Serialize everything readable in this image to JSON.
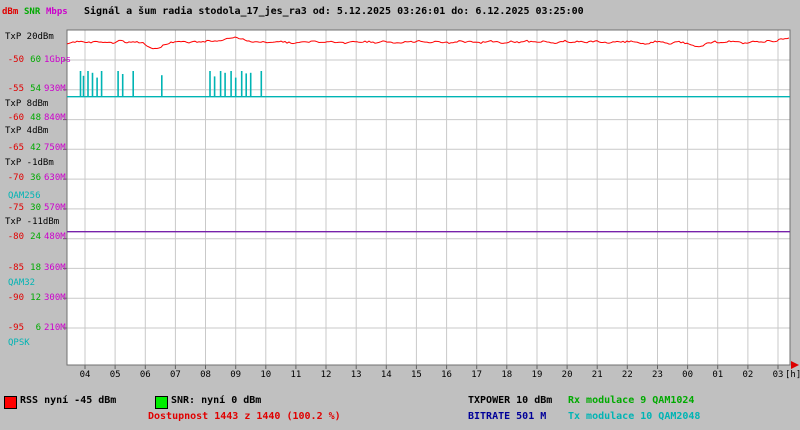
{
  "header": {
    "unit_dbm": "dBm",
    "unit_snr": "SNR",
    "unit_mbps": "Mbps",
    "title": "Signál a šum radia stodola_17_jes_ra3 od: 5.12.2025 03:26:01 do: 6.12.2025 03:25:00"
  },
  "colors": {
    "page_bg": "#c0c0c0",
    "plot_bg": "#ffffff",
    "grid": "#c9c9c9",
    "border": "#707070",
    "rss": "#ff0000",
    "snr_swatch": "#00ee00",
    "mbps_axis": "#cc00cc",
    "modulation": "#00b4b4",
    "bitrate_line": "#7722aa",
    "bitrate_text": "#000099",
    "rx_mod_text": "#00aa00",
    "availability_text": "#e00000"
  },
  "axis": {
    "left_rows": [
      {
        "y": 60,
        "dbm": "-50",
        "snr": "60",
        "mbps": "1Gbps"
      },
      {
        "y": 89,
        "dbm": "-55",
        "snr": "54",
        "mbps": "930M"
      },
      {
        "y": 118,
        "dbm": "-60",
        "snr": "48",
        "mbps": "840M"
      },
      {
        "y": 148,
        "dbm": "-65",
        "snr": "42",
        "mbps": "750M"
      },
      {
        "y": 178,
        "dbm": "-70",
        "snr": "36",
        "mbps": "630M"
      },
      {
        "y": 208,
        "dbm": "-75",
        "snr": "30",
        "mbps": "570M"
      },
      {
        "y": 237,
        "dbm": "-80",
        "snr": "24",
        "mbps": "480M"
      },
      {
        "y": 268,
        "dbm": "-85",
        "snr": "18",
        "mbps": "360M"
      },
      {
        "y": 298,
        "dbm": "-90",
        "snr": "12",
        "mbps": "300M"
      },
      {
        "y": 328,
        "dbm": "-95",
        "snr": "6",
        "mbps": "210M"
      }
    ],
    "txp_rows": [
      {
        "y": 37,
        "label": "TxP 20dBm"
      },
      {
        "y": 104,
        "label": "TxP 8dBm"
      },
      {
        "y": 131,
        "label": "TxP 4dBm"
      },
      {
        "y": 163,
        "label": "TxP -1dBm"
      },
      {
        "y": 222,
        "label": "TxP -11dBm"
      }
    ],
    "mod_rows": [
      {
        "y": 196,
        "label": "QAM256"
      },
      {
        "y": 283,
        "label": "QAM32"
      },
      {
        "y": 343,
        "label": "QPSK"
      }
    ],
    "x_labels": [
      "04",
      "05",
      "06",
      "07",
      "08",
      "09",
      "10",
      "11",
      "12",
      "13",
      "14",
      "15",
      "16",
      "17",
      "18",
      "19",
      "20",
      "21",
      "22",
      "23",
      "00",
      "01",
      "02",
      "03"
    ],
    "x_unit": "[h]"
  },
  "legend": {
    "rss": "RSS nyní -45 dBm",
    "snr": "SNR: nyní 0 dBm",
    "availability": "Dostupnost 1443 z 1440 (100.2 %)",
    "txpower": "TXPOWER 10 dBm",
    "rx_mod": "Rx modulace 9 QAM1024",
    "bitrate": "BITRATE 501 M",
    "tx_mod": "Tx modulace 10 QAM2048"
  },
  "chart_data": {
    "type": "line",
    "title": "Signál a šum radia stodola_17_jes_ra3",
    "time_from": "5.12.2025 03:26:01",
    "time_to": "6.12.2025 03:25:00",
    "x_axis": {
      "unit": "[h]",
      "tick_labels": [
        "04",
        "05",
        "06",
        "07",
        "08",
        "09",
        "10",
        "11",
        "12",
        "13",
        "14",
        "15",
        "16",
        "17",
        "18",
        "19",
        "20",
        "21",
        "22",
        "23",
        "00",
        "01",
        "02",
        "03"
      ],
      "start_hour": 3.43,
      "end_hour": 27.42
    },
    "y_axes": {
      "rss_dbm_ticks": [
        -50,
        -55,
        -60,
        -65,
        -70,
        -75,
        -80,
        -85,
        -90,
        -95
      ],
      "snr_db_ticks": [
        60,
        54,
        48,
        42,
        36,
        30,
        24,
        18,
        12,
        6
      ],
      "bitrate_tick_labels": [
        "1Gbps",
        "930M",
        "840M",
        "750M",
        "630M",
        "570M",
        "480M",
        "360M",
        "300M",
        "210M"
      ],
      "txp_dbm_ticks": [
        20,
        8,
        4,
        -1,
        -11
      ],
      "modulation_ticks": [
        "QAM256",
        "QAM32",
        "QPSK"
      ]
    },
    "series": [
      {
        "name": "RSS",
        "unit": "dBm",
        "now": -45,
        "color": "#ff0000",
        "start_hour": 3.4,
        "step_hours": 0.25,
        "values": [
          -47.3,
          -47.0,
          -46.8,
          -47.1,
          -46.9,
          -47.0,
          -47.2,
          -46.8,
          -47.0,
          -46.9,
          -47.1,
          -47.9,
          -48.2,
          -47.4,
          -47.0,
          -46.8,
          -47.1,
          -46.9,
          -47.0,
          -46.7,
          -46.9,
          -46.5,
          -46.2,
          -46.4,
          -46.8,
          -47.0,
          -46.9,
          -47.1,
          -46.8,
          -47.0,
          -47.2,
          -46.9,
          -47.0,
          -46.8,
          -47.1,
          -46.9,
          -47.0,
          -47.2,
          -46.8,
          -47.0,
          -46.9,
          -47.1,
          -46.8,
          -47.0,
          -47.2,
          -46.9,
          -47.0,
          -46.8,
          -47.1,
          -46.9,
          -47.0,
          -47.2,
          -46.8,
          -47.0,
          -46.9,
          -47.1,
          -46.8,
          -47.0,
          -47.2,
          -46.9,
          -47.0,
          -46.8,
          -47.1,
          -46.9,
          -47.0,
          -47.2,
          -46.8,
          -47.0,
          -46.9,
          -47.1,
          -46.8,
          -47.0,
          -47.2,
          -46.9,
          -47.0,
          -46.8,
          -47.1,
          -47.3,
          -46.9,
          -47.0,
          -47.4,
          -46.9,
          -47.1,
          -47.5,
          -47.8,
          -47.2,
          -46.9,
          -47.1,
          -46.8,
          -47.0,
          -47.2,
          -46.9,
          -47.0,
          -46.8,
          -46.8,
          -46.5,
          -46.4
        ]
      },
      {
        "name": "TXPOWER",
        "unit": "dBm",
        "now": 10,
        "constant": 10,
        "color": "#00b4b4",
        "bursts": {
          "hours": [
            3.85,
            3.95,
            4.1,
            4.25,
            4.4,
            4.55,
            5.1,
            5.25,
            5.6,
            6.55,
            8.15,
            8.3,
            8.5,
            8.65,
            8.85,
            9.0,
            9.2,
            9.35,
            9.5,
            9.85
          ],
          "values": [
            14.3,
            13.5,
            14.3,
            14.0,
            13.2,
            14.3,
            14.3,
            13.8,
            14.3,
            13.6,
            14.3,
            13.4,
            14.3,
            14.0,
            14.3,
            13.2,
            14.3,
            13.9,
            14.0,
            14.3
          ]
        }
      },
      {
        "name": "BITRATE",
        "unit": "Mbps",
        "now": 501,
        "constant": 501,
        "color": "#7722aa"
      },
      {
        "name": "SNR",
        "unit": "dBm",
        "now": 0,
        "constant": 0,
        "color": "#00ee00"
      },
      {
        "name": "Rx modulace",
        "now": 9,
        "label": "QAM1024"
      },
      {
        "name": "Tx modulace",
        "now": 10,
        "label": "QAM2048"
      }
    ],
    "availability": {
      "measured": 1443,
      "expected": 1440,
      "percent": 100.2
    }
  }
}
